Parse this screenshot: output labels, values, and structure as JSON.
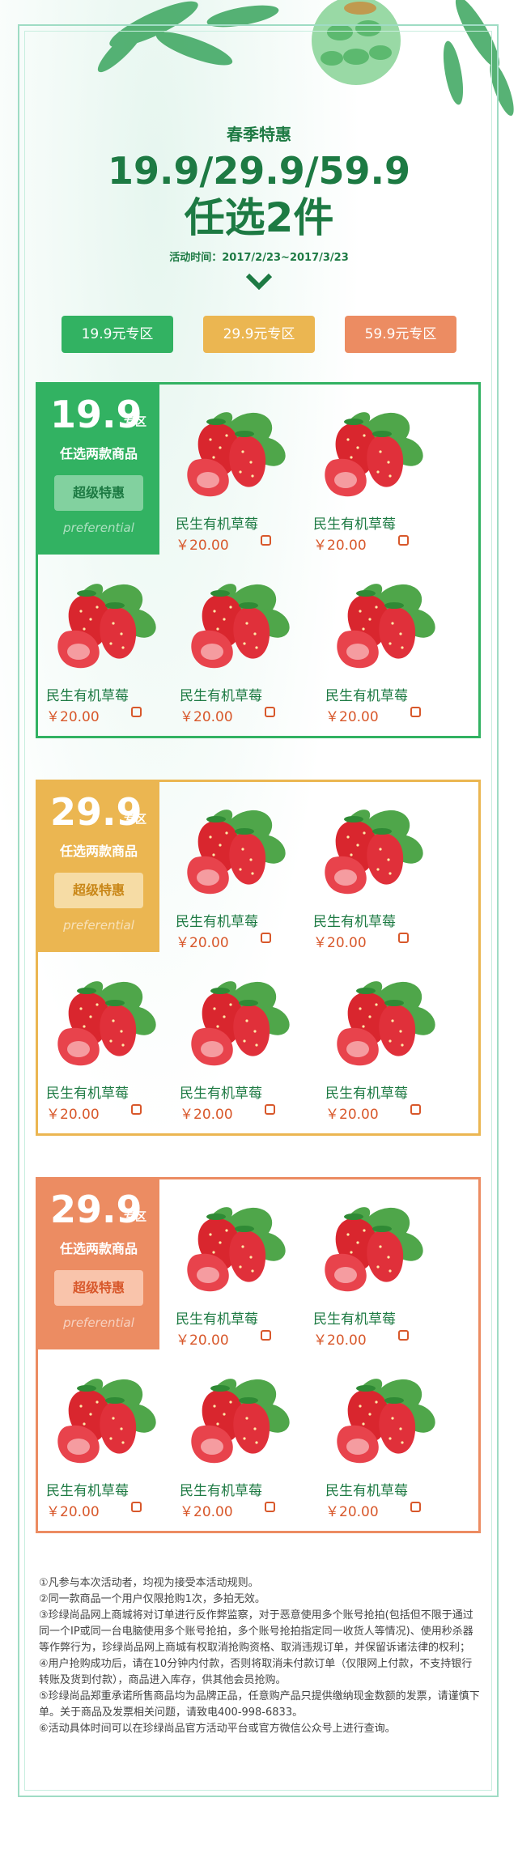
{
  "header": {
    "subtitle": "春季特惠",
    "prices": "19.9/29.9/59.9",
    "pick": "任选2件",
    "time": "活动时间：2017/2/23~2017/3/23"
  },
  "tabs": [
    {
      "label": "19.9元专区"
    },
    {
      "label": "29.9元专区"
    },
    {
      "label": "59.9元专区"
    }
  ],
  "sections": [
    {
      "price": "19.9",
      "zone": "专区",
      "pick": "任选两款商品",
      "badge": "超级特惠",
      "eng": "preferential",
      "products": [
        {
          "name": "民生有机草莓",
          "price": "￥20.00"
        },
        {
          "name": "民生有机草莓",
          "price": "￥20.00"
        },
        {
          "name": "民生有机草莓",
          "price": "￥20.00"
        },
        {
          "name": "民生有机草莓",
          "price": "￥20.00"
        },
        {
          "name": "民生有机草莓",
          "price": "￥20.00"
        }
      ]
    },
    {
      "price": "29.9",
      "zone": "专区",
      "pick": "任选两款商品",
      "badge": "超级特惠",
      "eng": "preferential",
      "products": [
        {
          "name": "民生有机草莓",
          "price": "￥20.00"
        },
        {
          "name": "民生有机草莓",
          "price": "￥20.00"
        },
        {
          "name": "民生有机草莓",
          "price": "￥20.00"
        },
        {
          "name": "民生有机草莓",
          "price": "￥20.00"
        },
        {
          "name": "民生有机草莓",
          "price": "￥20.00"
        }
      ]
    },
    {
      "price": "29.9",
      "zone": "专区",
      "pick": "任选两款商品",
      "badge": "超级特惠",
      "eng": "preferential",
      "products": [
        {
          "name": "民生有机草莓",
          "price": "￥20.00"
        },
        {
          "name": "民生有机草莓",
          "price": "￥20.00"
        },
        {
          "name": "民生有机草莓",
          "price": "￥20.00"
        },
        {
          "name": "民生有机草莓",
          "price": "￥20.00"
        },
        {
          "name": "民生有机草莓",
          "price": "￥20.00"
        }
      ]
    }
  ],
  "notes": [
    "①凡参与本次活动者，均视为接受本活动规则。",
    "②同一款商品一个用户仅限抢购1次，多拍无效。",
    "③珍绿尚品网上商城将对订单进行反作弊监察，对于恶意使用多个账号抢拍(包括但不限于通过同一个IP或同一台电脑使用多个账号抢拍，多个账号抢拍指定同一收货人等情况)、使用秒杀器等作弊行为，珍绿尚品网上商城有权取消抢购资格、取消违规订单，并保留诉诸法律的权利；",
    "④用户抢购成功后，请在10分钟内付款，否则将取消未付款订单（仅限网上付款，不支持银行转账及货到付款），商品进入库存，供其他会员抢购。",
    "⑤珍绿尚品郑重承诺所售商品均为品牌正品，任意购产品只提供缴纳现金数额的发票，请谨慎下单。关于商品及发票相关问题，请致电400-998-6833。",
    "⑥活动具体时间可以在珍绿尚品官方活动平台或官方微信公众号上进行查询。"
  ],
  "colors": {
    "green": "#32b262",
    "yellow": "#ebb651",
    "orange": "#ec8c62",
    "dark_green": "#1d7a43"
  }
}
